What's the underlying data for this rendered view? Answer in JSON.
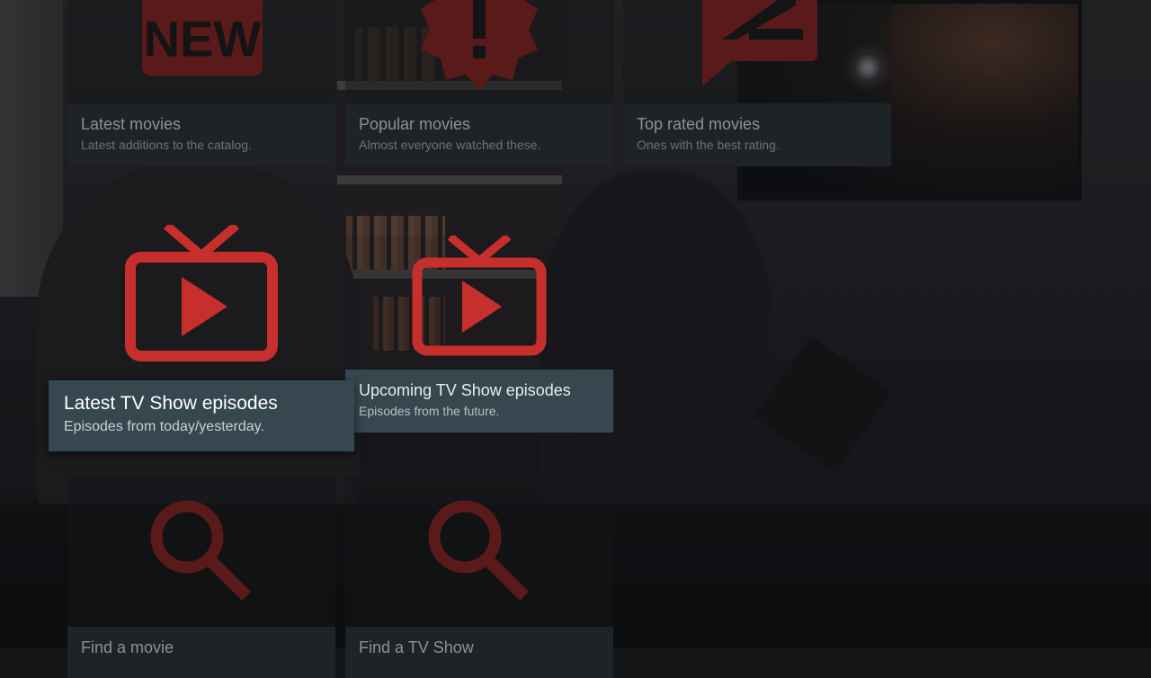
{
  "colors": {
    "accent": "#c62f2c",
    "accent_dim": "#5a1a1a",
    "caption_bg": "#37474f",
    "caption_bg_dim": "#1e2327"
  },
  "tiles": [
    {
      "id": "latest-movies",
      "icon": "new-badge-icon",
      "title": "Latest movies",
      "subtitle": "Latest additions to the catalog.",
      "state": "dim"
    },
    {
      "id": "popular-movies",
      "icon": "exclamation-badge-icon",
      "title": "Popular movies",
      "subtitle": "Almost everyone watched these.",
      "state": "dim"
    },
    {
      "id": "top-rated-movies",
      "icon": "rate-review-icon",
      "title": "Top rated movies",
      "subtitle": "Ones with the best rating.",
      "state": "dim"
    },
    {
      "id": "latest-tv-episodes",
      "icon": "live-tv-icon",
      "title": "Latest TV Show episodes",
      "subtitle": "Episodes from today/yesterday.",
      "state": "focused"
    },
    {
      "id": "upcoming-tv-episodes",
      "icon": "live-tv-icon",
      "title": "Upcoming TV Show episodes",
      "subtitle": "Episodes from the future.",
      "state": "active"
    },
    {
      "id": "find-movie",
      "icon": "search-icon",
      "title": "Find a movie",
      "subtitle": "",
      "state": "dim"
    },
    {
      "id": "find-tv-show",
      "icon": "search-icon",
      "title": "Find a TV Show",
      "subtitle": "",
      "state": "dim"
    }
  ]
}
